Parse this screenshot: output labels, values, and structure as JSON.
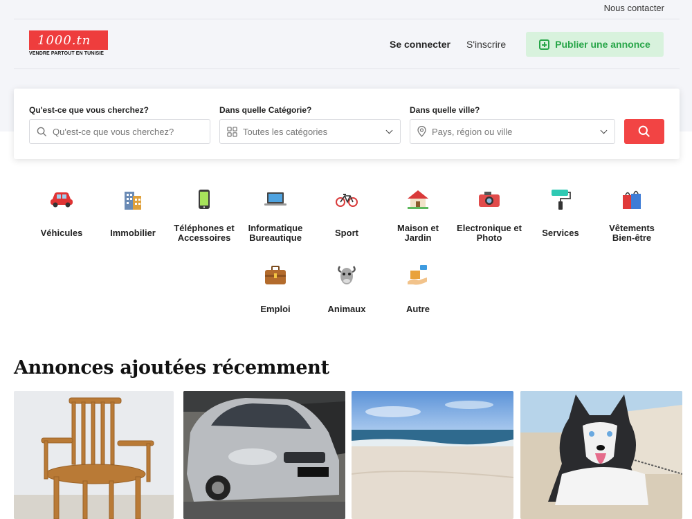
{
  "topbar": {
    "contact": "Nous contacter"
  },
  "header": {
    "logo_text": "1000.tn",
    "logo_tagline": "VENDRE PARTOUT EN TUNISIE",
    "login": "Se connecter",
    "register": "S'inscrire",
    "publish": "Publier une annonce"
  },
  "search": {
    "what_label": "Qu'est-ce que vous cherchez?",
    "what_placeholder": "Qu'est-ce que vous cherchez?",
    "category_label": "Dans quelle Catégorie?",
    "category_value": "Toutes les catégories",
    "city_label": "Dans quelle ville?",
    "city_placeholder": "Pays, région ou ville"
  },
  "categories": [
    {
      "label": "Véhicules",
      "icon": "car-icon"
    },
    {
      "label": "Immobilier",
      "icon": "building-icon"
    },
    {
      "label": "Téléphones et Accessoires",
      "icon": "phone-icon"
    },
    {
      "label": "Informatique Bureautique",
      "icon": "laptop-icon"
    },
    {
      "label": "Sport",
      "icon": "bicycle-icon"
    },
    {
      "label": "Maison et Jardin",
      "icon": "house-icon"
    },
    {
      "label": "Electronique et Photo",
      "icon": "camera-icon"
    },
    {
      "label": "Services",
      "icon": "paint-roller-icon"
    },
    {
      "label": "Vêtements Bien-être",
      "icon": "shopping-bags-icon"
    },
    {
      "label": "Emploi",
      "icon": "briefcase-icon"
    },
    {
      "label": "Animaux",
      "icon": "goat-icon"
    },
    {
      "label": "Autre",
      "icon": "delivery-box-icon"
    }
  ],
  "recent": {
    "title": "Annonces ajoutées récemment",
    "items": [
      {
        "image": "wooden-chair"
      },
      {
        "image": "silver-car"
      },
      {
        "image": "beach"
      },
      {
        "image": "husky-dog"
      }
    ]
  },
  "colors": {
    "brand_red": "#ee3d3d",
    "publish_green": "#27a548",
    "publish_bg": "#d8f2dd",
    "search_red": "#f24444"
  }
}
